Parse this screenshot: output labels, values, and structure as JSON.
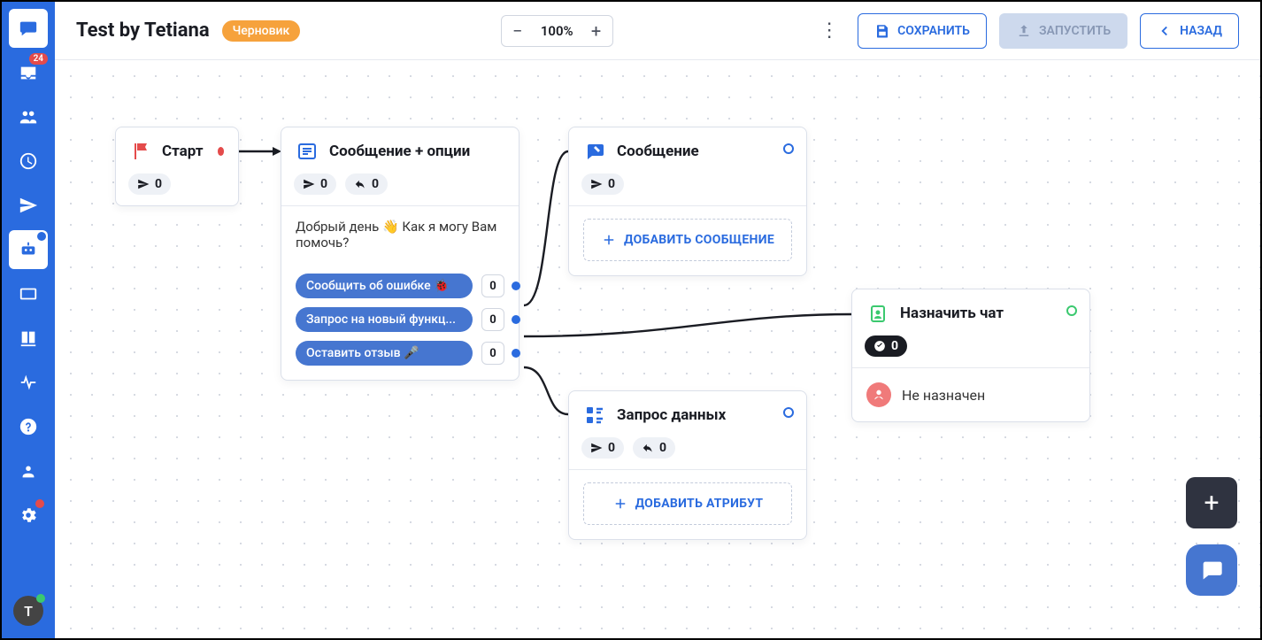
{
  "sidebar": {
    "inbox_badge": "24",
    "avatar_letter": "T"
  },
  "topbar": {
    "title": "Test by Tetiana",
    "draft_badge": "Черновик",
    "zoom": "100%",
    "save": "СОХРАНИТЬ",
    "launch": "ЗАПУСТИТЬ",
    "back": "НАЗАД"
  },
  "nodes": {
    "start": {
      "title": "Старт",
      "sent": "0"
    },
    "msg_opts": {
      "title": "Сообщение + опции",
      "sent": "0",
      "reply": "0",
      "body": "Добрый день 👋 Как я могу Вам помочь?",
      "options": [
        {
          "label": "Сообщить об ошибке 🐞",
          "count": "0"
        },
        {
          "label": "Запрос на новый функц...",
          "count": "0"
        },
        {
          "label": "Оставить отзыв 🎤",
          "count": "0"
        }
      ]
    },
    "msg": {
      "title": "Сообщение",
      "sent": "0",
      "add": "ДОБАВИТЬ СООБЩЕНИЕ"
    },
    "data": {
      "title": "Запрос данных",
      "sent": "0",
      "reply": "0",
      "add": "ДОБАВИТЬ АТРИБУТ"
    },
    "assign": {
      "title": "Назначить чат",
      "count": "0",
      "status": "Не назначен"
    }
  }
}
